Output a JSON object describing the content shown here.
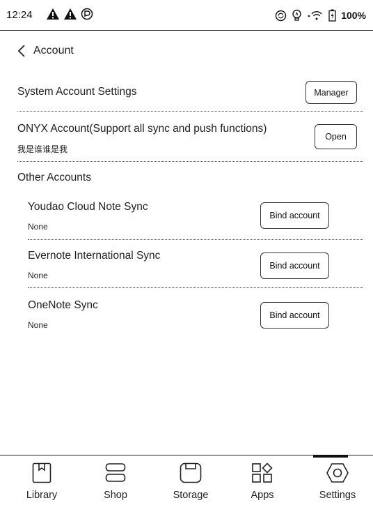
{
  "status_bar": {
    "time": "12:24",
    "battery": "100%",
    "icons": [
      "warning-icon",
      "warning-icon",
      "pocket-icon",
      "sync-icon",
      "bulb-icon",
      "wifi-icon",
      "battery-icon"
    ]
  },
  "header": {
    "title": "Account",
    "back_icon": "chevron-left-icon"
  },
  "system_account": {
    "title": "System Account Settings",
    "button": "Manager"
  },
  "onyx_account": {
    "title": "ONYX Account(Support all sync and push functions)",
    "subtitle": "我是谁谁是我",
    "button": "Open"
  },
  "other_accounts": {
    "section_title": "Other Accounts",
    "items": [
      {
        "title": "Youdao Cloud Note Sync",
        "status": "None",
        "button": "Bind account"
      },
      {
        "title": "Evernote International Sync",
        "status": "None",
        "button": "Bind account"
      },
      {
        "title": "OneNote Sync",
        "status": "None",
        "button": "Bind account"
      }
    ]
  },
  "bottom_nav": {
    "active": "Settings",
    "items": [
      {
        "label": "Library",
        "icon": "library-icon"
      },
      {
        "label": "Shop",
        "icon": "shop-icon"
      },
      {
        "label": "Storage",
        "icon": "storage-icon"
      },
      {
        "label": "Apps",
        "icon": "apps-icon"
      },
      {
        "label": "Settings",
        "icon": "settings-icon"
      }
    ]
  }
}
